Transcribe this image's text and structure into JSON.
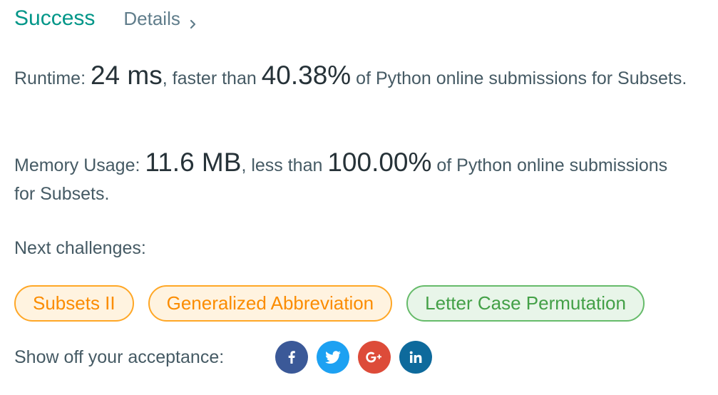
{
  "header": {
    "status": "Success",
    "details_label": "Details"
  },
  "runtime": {
    "label": "Runtime: ",
    "value": "24 ms",
    "comparison_prefix": ", faster than ",
    "percent": "40.38%",
    "suffix": " of Python online submissions for Subsets."
  },
  "memory": {
    "label": "Memory Usage: ",
    "value": "11.6 MB",
    "comparison_prefix": ", less than ",
    "percent": "100.00%",
    "suffix": " of Python online submissions for Subsets."
  },
  "next": {
    "label": "Next challenges:",
    "challenges": [
      {
        "title": "Subsets II",
        "difficulty": "medium"
      },
      {
        "title": "Generalized Abbreviation",
        "difficulty": "medium"
      },
      {
        "title": "Letter Case Permutation",
        "difficulty": "easy"
      }
    ]
  },
  "share": {
    "label": "Show off your acceptance:",
    "networks": [
      {
        "icon": "facebook-icon",
        "color": "#3b5998"
      },
      {
        "icon": "twitter-icon",
        "color": "#1da1f2"
      },
      {
        "icon": "google-plus-icon",
        "color": "#dd4b39"
      },
      {
        "icon": "linkedin-icon",
        "color": "#0e6a9c"
      }
    ]
  },
  "colors": {
    "success": "#009688",
    "medium_border": "#ffa726",
    "medium_text": "#fb8c00",
    "easy_border": "#66bb6a",
    "easy_text": "#43a047"
  }
}
